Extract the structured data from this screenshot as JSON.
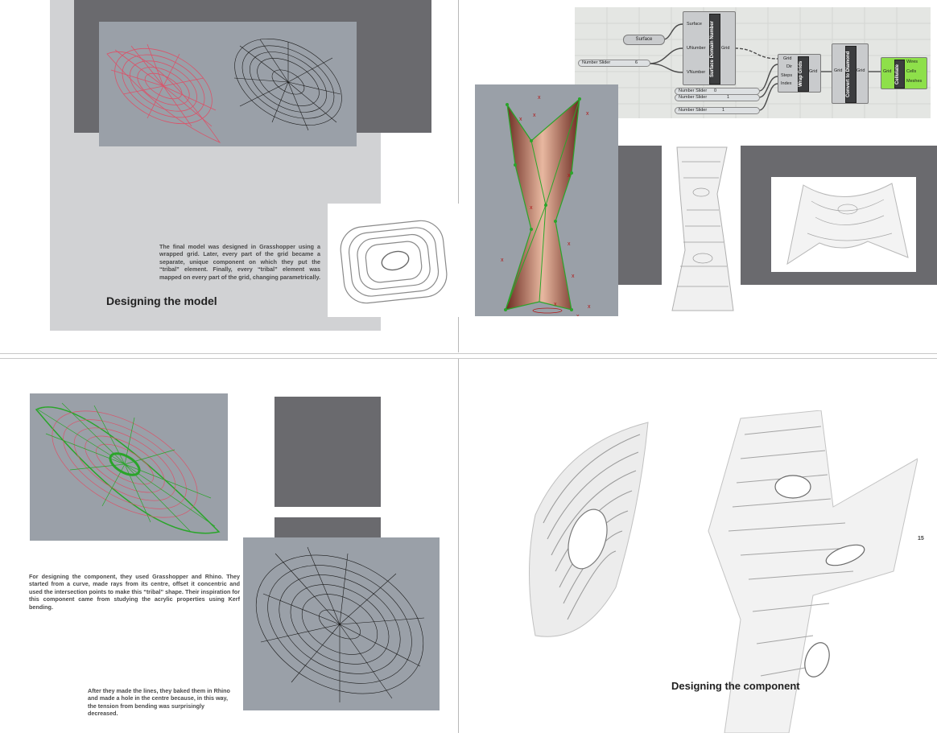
{
  "top_left_page": {
    "paragraph": "The final model was designed in Grasshopper using a wrapped grid. Later, every part of the grid became a separate, unique component on which they put the “tribal” element. Finally, every “tribal” element was mapped on every part of the grid, changing parametrically.",
    "heading": "Designing the model"
  },
  "top_right_page": {
    "grasshopper": {
      "surface_param": "Surface",
      "number_slider_1": "Number Slider",
      "number_slider_1_value": "6",
      "sdn_component": "Surface Domain Number",
      "sdn_in_surface": "Surface",
      "sdn_in_u": "UNumber",
      "sdn_in_v": "VNumber",
      "sdn_out": "Grid",
      "wrap_component": "Wrap Grids",
      "wrap_in_grid": "Grid",
      "wrap_in_dir": "Dir",
      "wrap_in_steps": "Steps",
      "wrap_in_index": "Index",
      "wrap_out": "Grid",
      "diamond_component": "Convert to Diamond",
      "diamond_in": "Grid",
      "diamond_out": "Grid",
      "cellulate_component": "Cellulate",
      "cellulate_in": "Grid",
      "cellulate_out_wires": "Wires",
      "cellulate_out_cells": "Cells",
      "cellulate_out_meshes": "Meshes",
      "slider_a": "Number Slider",
      "slider_a_value": "0",
      "slider_b": "Number Slider",
      "slider_b_value": "1",
      "slider_c": "Number Slider",
      "slider_c_value": "1"
    }
  },
  "bottom_left_page": {
    "paragraph_1": "For designing the component, they used Grasshopper and Rhino. They started from a curve, made rays from its centre, offset it concentric and used the intersection points to make this “tribal” shape. Their inspiration for this component came from studying the acrylic properties using Kerf bending.",
    "paragraph_2": "After they made the lines, they baked them in Rhino and made a hole in the centre because, in this way, the tension from bending was surprisingly decreased."
  },
  "bottom_right_page": {
    "page_number": "15",
    "heading": "Designing the component"
  },
  "colors": {
    "dark_gray": "#6a6a6e",
    "light_gray": "#d1d2d4",
    "viewport_gray": "#9aa0a8",
    "red_curve": "#d9546a",
    "green_point": "#2aa52a",
    "cellulate_green": "#8ee04a"
  }
}
